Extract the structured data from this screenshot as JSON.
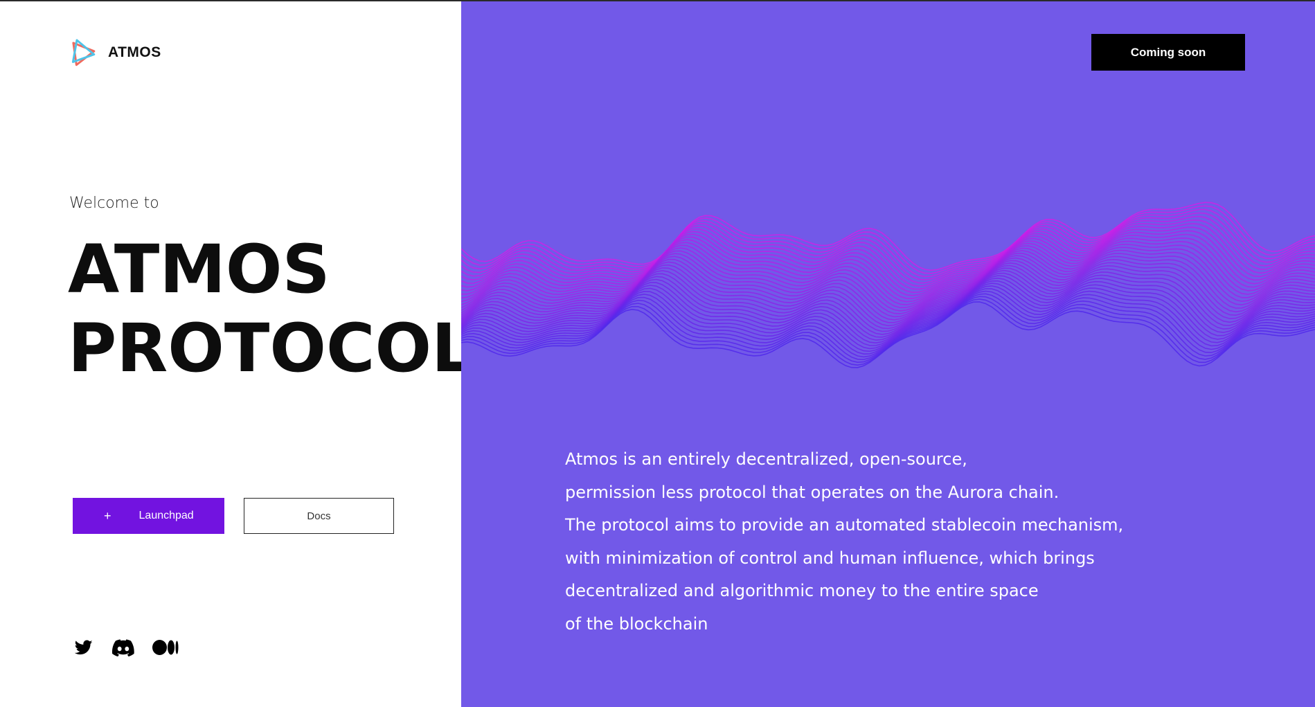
{
  "brand": {
    "name": "ATMOS"
  },
  "hero": {
    "welcome": "Welcome to",
    "title_line1": "ATMOS",
    "title_line2": "PROTOCOL"
  },
  "buttons": {
    "launchpad_icon": "+",
    "launchpad_label": "Launchpad",
    "docs_label": "Docs",
    "coming_soon_label": "Coming soon"
  },
  "socials": [
    {
      "icon": "twitter-icon"
    },
    {
      "icon": "discord-icon"
    },
    {
      "icon": "medium-icon"
    }
  ],
  "description": {
    "lines": [
      "Atmos is an entirely decentralized, open-source,",
      "permission less protocol that operates on the Aurora chain.",
      "The protocol aims to provide an automated stablecoin mechanism,",
      "with minimization of control and human influence, which brings",
      "decentralized and algorithmic money to the entire space",
      "of the blockchain"
    ]
  },
  "colors": {
    "panel_background": "#7259e8",
    "launchpad_button": "#7213e0",
    "wave_top": "#d21ee6",
    "wave_bottom": "#4a28e6"
  }
}
